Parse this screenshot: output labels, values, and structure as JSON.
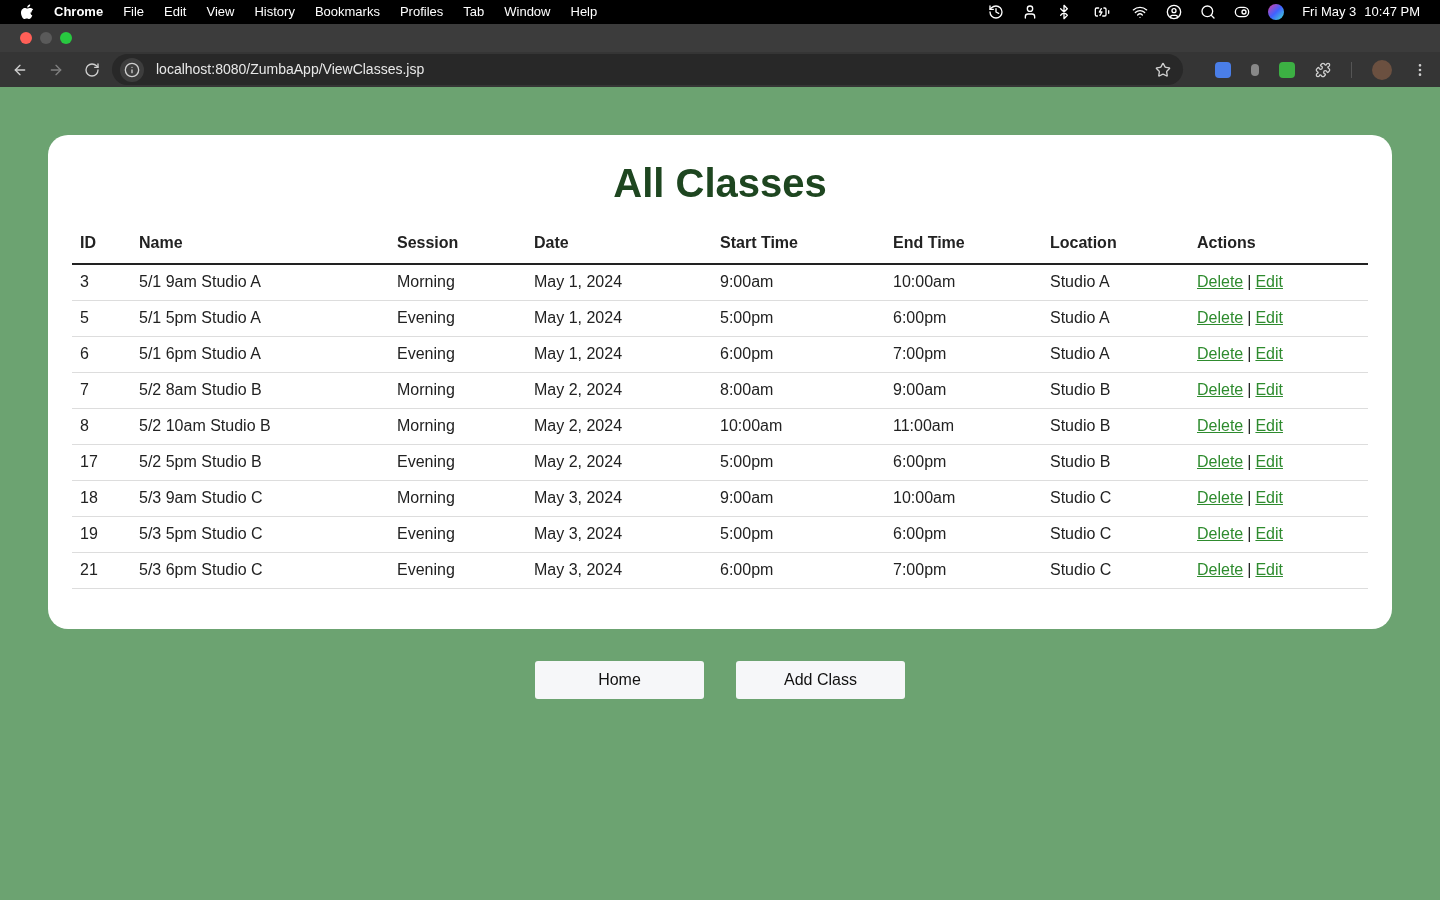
{
  "menubar": {
    "app": "Chrome",
    "items": [
      "File",
      "Edit",
      "View",
      "History",
      "Bookmarks",
      "Profiles",
      "Tab",
      "Window",
      "Help"
    ],
    "date": "Fri May 3",
    "time": "10:47 PM"
  },
  "browser": {
    "url": "localhost:8080/ZumbaApp/ViewClasses.jsp"
  },
  "page": {
    "title": "All Classes",
    "table": {
      "columns": [
        "ID",
        "Name",
        "Session",
        "Date",
        "Start Time",
        "End Time",
        "Location",
        "Actions"
      ],
      "rows": [
        {
          "cells": [
            "3",
            "5/1 9am Studio A",
            "Morning",
            "May 1, 2024",
            "9:00am",
            "10:00am",
            "Studio A"
          ],
          "actions": [
            "Delete",
            "|",
            "Edit"
          ]
        },
        {
          "cells": [
            "5",
            "5/1 5pm Studio A",
            "Evening",
            "May 1, 2024",
            "5:00pm",
            "6:00pm",
            "Studio A"
          ],
          "actions": [
            "Delete",
            "|",
            "Edit"
          ]
        },
        {
          "cells": [
            "6",
            "5/1 6pm Studio A",
            "Evening",
            "May 1, 2024",
            "6:00pm",
            "7:00pm",
            "Studio A"
          ],
          "actions": [
            "Delete",
            "|",
            "Edit"
          ]
        },
        {
          "cells": [
            "7",
            "5/2 8am Studio B",
            "Morning",
            "May 2, 2024",
            "8:00am",
            "9:00am",
            "Studio B"
          ],
          "actions": [
            "Delete",
            "|",
            "Edit"
          ]
        },
        {
          "cells": [
            "8",
            "5/2 10am Studio B",
            "Morning",
            "May 2, 2024",
            "10:00am",
            "11:00am",
            "Studio B"
          ],
          "actions": [
            "Delete",
            "|",
            "Edit"
          ]
        },
        {
          "cells": [
            "17",
            "5/2 5pm Studio B",
            "Evening",
            "May 2, 2024",
            "5:00pm",
            "6:00pm",
            "Studio B"
          ],
          "actions": [
            "Delete",
            "|",
            "Edit"
          ]
        },
        {
          "cells": [
            "18",
            "5/3 9am Studio C",
            "Morning",
            "May 3, 2024",
            "9:00am",
            "10:00am",
            "Studio C"
          ],
          "actions": [
            "Delete",
            "|",
            "Edit"
          ]
        },
        {
          "cells": [
            "19",
            "5/3 5pm Studio C",
            "Evening",
            "May 3, 2024",
            "5:00pm",
            "6:00pm",
            "Studio C"
          ],
          "actions": [
            "Delete",
            "|",
            "Edit"
          ]
        },
        {
          "cells": [
            "21",
            "5/3 6pm Studio C",
            "Evening",
            "May 3, 2024",
            "6:00pm",
            "7:00pm",
            "Studio C"
          ],
          "actions": [
            "Delete",
            "|",
            "Edit"
          ]
        }
      ]
    },
    "buttons": [
      "Home",
      "Add Class"
    ]
  }
}
